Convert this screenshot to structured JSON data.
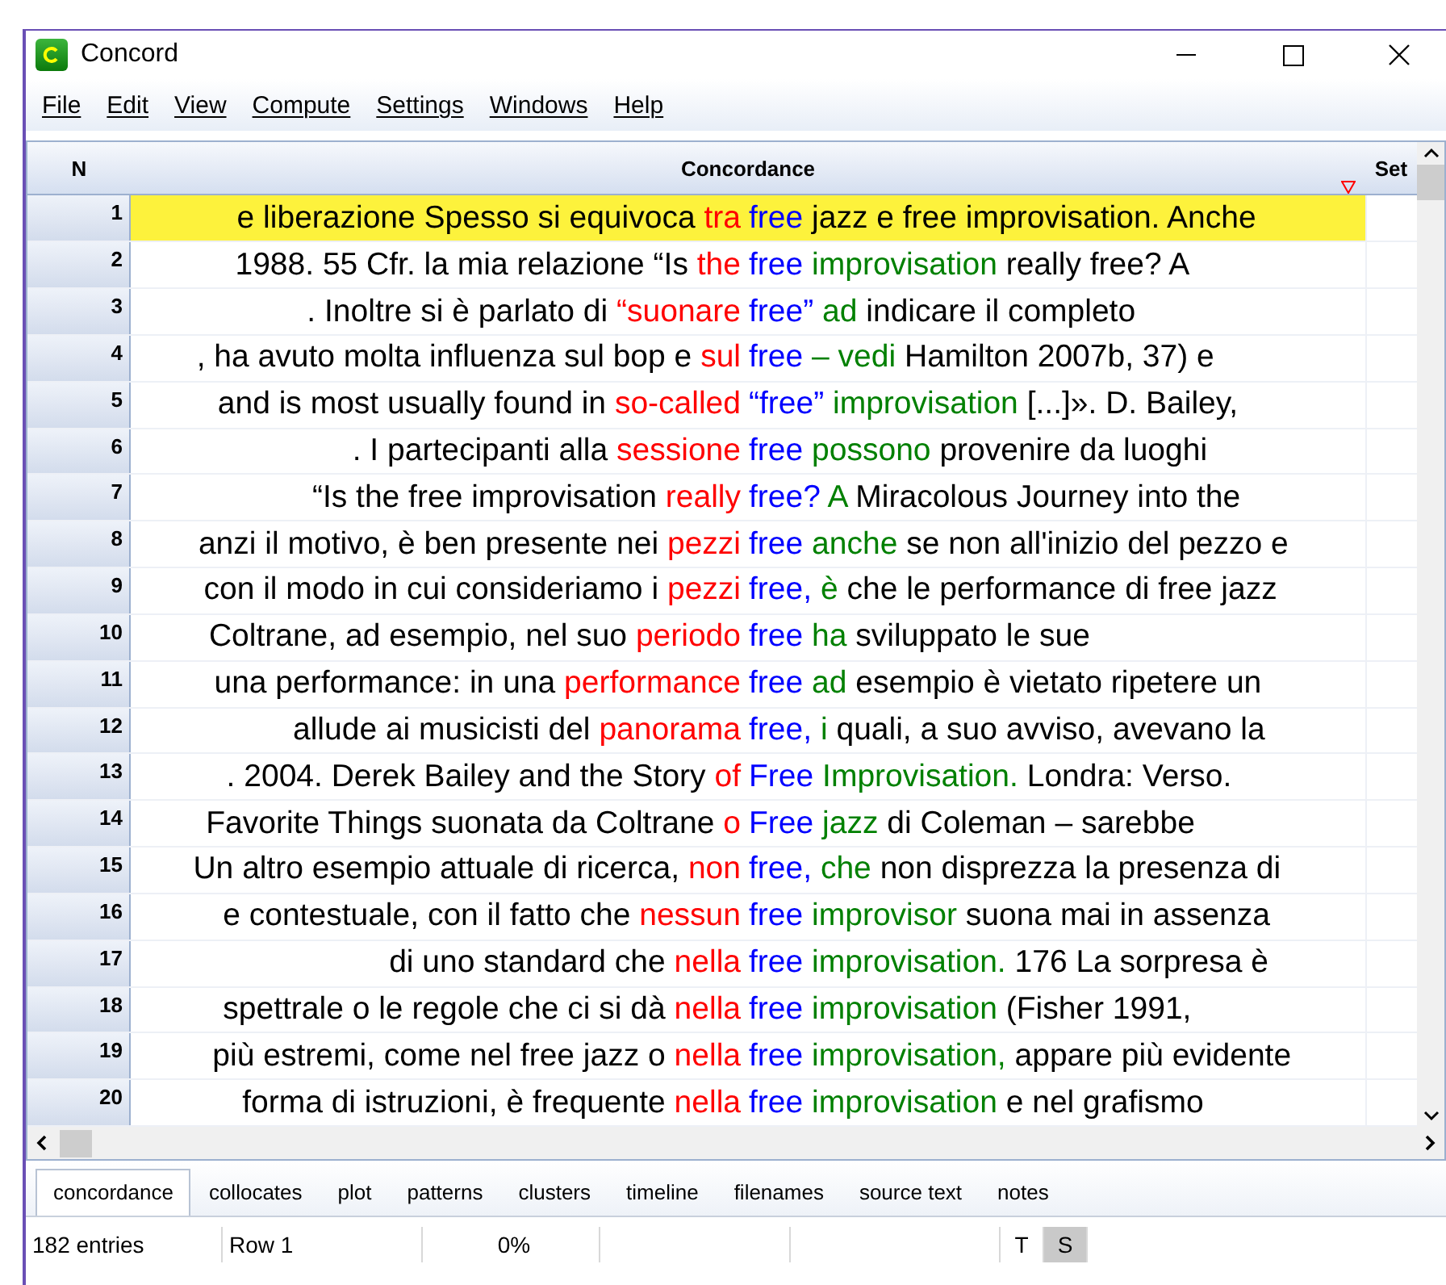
{
  "window": {
    "title": "Concord"
  },
  "menu": [
    "File",
    "Edit",
    "View",
    "Compute",
    "Settings",
    "Windows",
    "Help"
  ],
  "columns": [
    "N",
    "Concordance",
    "Set"
  ],
  "rows": [
    {
      "n": "1",
      "selected": true,
      "segments": [
        {
          "kind": "plain",
          "text": "e liberazione Spesso si equivoca"
        },
        {
          "kind": "left",
          "text": "tra"
        },
        {
          "kind": "node",
          "text": "free"
        },
        {
          "kind": "plain",
          "text": "jazz e free improvisation. Anche"
        }
      ]
    },
    {
      "n": "2",
      "selected": false,
      "segments": [
        {
          "kind": "plain",
          "text": "1988. 55 Cfr. la mia relazione “Is"
        },
        {
          "kind": "left",
          "text": "the"
        },
        {
          "kind": "node",
          "text": "free"
        },
        {
          "kind": "right",
          "text": "improvisation"
        },
        {
          "kind": "plain",
          "text": "really free? A"
        }
      ]
    },
    {
      "n": "3",
      "selected": false,
      "segments": [
        {
          "kind": "plain",
          "text": ". Inoltre si è parlato di"
        },
        {
          "kind": "left",
          "text": "“suonare"
        },
        {
          "kind": "node",
          "text": "free”"
        },
        {
          "kind": "right",
          "text": "ad"
        },
        {
          "kind": "plain",
          "text": "indicare il completo"
        }
      ]
    },
    {
      "n": "4",
      "selected": false,
      "segments": [
        {
          "kind": "plain",
          "text": ", ha avuto molta influenza sul bop e"
        },
        {
          "kind": "left",
          "text": "sul"
        },
        {
          "kind": "node",
          "text": "free"
        },
        {
          "kind": "right",
          "text": "– vedi"
        },
        {
          "kind": "plain",
          "text": "Hamilton 2007b, 37) e"
        }
      ]
    },
    {
      "n": "5",
      "selected": false,
      "segments": [
        {
          "kind": "plain",
          "text": "and is most usually found in"
        },
        {
          "kind": "left",
          "text": "so-called"
        },
        {
          "kind": "node",
          "text": "“free”"
        },
        {
          "kind": "right",
          "text": "improvisation"
        },
        {
          "kind": "plain",
          "text": "[...]». D. Bailey,"
        }
      ]
    },
    {
      "n": "6",
      "selected": false,
      "segments": [
        {
          "kind": "plain",
          "text": ". I partecipanti alla"
        },
        {
          "kind": "left",
          "text": "sessione"
        },
        {
          "kind": "node",
          "text": "free"
        },
        {
          "kind": "right",
          "text": "possono"
        },
        {
          "kind": "plain",
          "text": "provenire da luoghi"
        }
      ]
    },
    {
      "n": "7",
      "selected": false,
      "segments": [
        {
          "kind": "plain",
          "text": "“Is the free improvisation"
        },
        {
          "kind": "left",
          "text": "really"
        },
        {
          "kind": "node",
          "text": "free?"
        },
        {
          "kind": "right",
          "text": "A"
        },
        {
          "kind": "plain",
          "text": "Miracolous Journey into the"
        }
      ]
    },
    {
      "n": "8",
      "selected": false,
      "segments": [
        {
          "kind": "plain",
          "text": "anzi il motivo, è ben presente nei"
        },
        {
          "kind": "left",
          "text": "pezzi"
        },
        {
          "kind": "node",
          "text": "free"
        },
        {
          "kind": "right",
          "text": "anche"
        },
        {
          "kind": "plain",
          "text": "se non all'inizio del pezzo e"
        }
      ]
    },
    {
      "n": "9",
      "selected": false,
      "segments": [
        {
          "kind": "plain",
          "text": "con il modo in cui consideriamo i"
        },
        {
          "kind": "left",
          "text": "pezzi"
        },
        {
          "kind": "node",
          "text": "free,"
        },
        {
          "kind": "right",
          "text": "è"
        },
        {
          "kind": "plain",
          "text": "che le performance di free jazz"
        }
      ]
    },
    {
      "n": "10",
      "selected": false,
      "segments": [
        {
          "kind": "plain",
          "text": "Coltrane, ad esempio, nel suo"
        },
        {
          "kind": "left",
          "text": "periodo"
        },
        {
          "kind": "node",
          "text": "free"
        },
        {
          "kind": "right",
          "text": "ha"
        },
        {
          "kind": "plain",
          "text": "sviluppato le sue"
        }
      ]
    },
    {
      "n": "11",
      "selected": false,
      "segments": [
        {
          "kind": "plain",
          "text": "una performance: in una"
        },
        {
          "kind": "left",
          "text": "performance"
        },
        {
          "kind": "node",
          "text": "free"
        },
        {
          "kind": "right",
          "text": "ad"
        },
        {
          "kind": "plain",
          "text": "esempio è vietato ripetere un"
        }
      ]
    },
    {
      "n": "12",
      "selected": false,
      "segments": [
        {
          "kind": "plain",
          "text": "allude ai musicisti del"
        },
        {
          "kind": "left",
          "text": "panorama"
        },
        {
          "kind": "node",
          "text": "free,"
        },
        {
          "kind": "right",
          "text": "i"
        },
        {
          "kind": "plain",
          "text": "quali, a suo avviso, avevano la"
        }
      ]
    },
    {
      "n": "13",
      "selected": false,
      "segments": [
        {
          "kind": "plain",
          "text": ". 2004. Derek Bailey and the Story"
        },
        {
          "kind": "left",
          "text": "of"
        },
        {
          "kind": "node",
          "text": "Free"
        },
        {
          "kind": "right",
          "text": "Improvisation."
        },
        {
          "kind": "plain",
          "text": "Londra: Verso."
        }
      ]
    },
    {
      "n": "14",
      "selected": false,
      "segments": [
        {
          "kind": "plain",
          "text": "Favorite Things suonata da Coltrane"
        },
        {
          "kind": "left",
          "text": "o"
        },
        {
          "kind": "node",
          "text": "Free"
        },
        {
          "kind": "right",
          "text": "jazz"
        },
        {
          "kind": "plain",
          "text": "di Coleman – sarebbe"
        }
      ]
    },
    {
      "n": "15",
      "selected": false,
      "segments": [
        {
          "kind": "plain",
          "text": "Un altro esempio attuale di ricerca,"
        },
        {
          "kind": "left",
          "text": "non"
        },
        {
          "kind": "node",
          "text": "free,"
        },
        {
          "kind": "right",
          "text": "che"
        },
        {
          "kind": "plain",
          "text": "non disprezza la presenza di"
        }
      ]
    },
    {
      "n": "16",
      "selected": false,
      "segments": [
        {
          "kind": "plain",
          "text": "e contestuale, con il fatto che"
        },
        {
          "kind": "left",
          "text": "nessun"
        },
        {
          "kind": "node",
          "text": "free"
        },
        {
          "kind": "right",
          "text": "improvisor"
        },
        {
          "kind": "plain",
          "text": "suona mai in assenza"
        }
      ]
    },
    {
      "n": "17",
      "selected": false,
      "segments": [
        {
          "kind": "plain",
          "text": "di uno standard che"
        },
        {
          "kind": "left",
          "text": "nella"
        },
        {
          "kind": "node",
          "text": "free"
        },
        {
          "kind": "right",
          "text": "improvisation."
        },
        {
          "kind": "plain",
          "text": "176 La sorpresa è"
        }
      ]
    },
    {
      "n": "18",
      "selected": false,
      "segments": [
        {
          "kind": "plain",
          "text": "spettrale o le regole che ci si dà"
        },
        {
          "kind": "left",
          "text": "nella"
        },
        {
          "kind": "node",
          "text": "free"
        },
        {
          "kind": "right",
          "text": "improvisation"
        },
        {
          "kind": "plain",
          "text": "(Fisher 1991,"
        }
      ]
    },
    {
      "n": "19",
      "selected": false,
      "segments": [
        {
          "kind": "plain",
          "text": "più estremi, come nel free jazz o"
        },
        {
          "kind": "left",
          "text": "nella"
        },
        {
          "kind": "node",
          "text": "free"
        },
        {
          "kind": "right",
          "text": "improvisation,"
        },
        {
          "kind": "plain",
          "text": "appare più evidente"
        }
      ]
    },
    {
      "n": "20",
      "selected": false,
      "segments": [
        {
          "kind": "plain",
          "text": "forma di istruzioni, è frequente"
        },
        {
          "kind": "left",
          "text": "nella"
        },
        {
          "kind": "node",
          "text": "free"
        },
        {
          "kind": "right",
          "text": "improvisation"
        },
        {
          "kind": "plain",
          "text": "e nel grafismo"
        }
      ]
    }
  ],
  "tabs": [
    {
      "label": "concordance",
      "selected": true
    },
    {
      "label": "collocates",
      "selected": false
    },
    {
      "label": "plot",
      "selected": false
    },
    {
      "label": "patterns",
      "selected": false
    },
    {
      "label": "clusters",
      "selected": false
    },
    {
      "label": "timeline",
      "selected": false
    },
    {
      "label": "filenames",
      "selected": false
    },
    {
      "label": "source text",
      "selected": false
    },
    {
      "label": "notes",
      "selected": false
    }
  ],
  "status_bar": [
    {
      "text": "182 entries",
      "kind": "text"
    },
    {
      "text": "Row 1",
      "kind": "text"
    },
    {
      "text": "0%",
      "kind": "text"
    },
    {
      "text": "T",
      "kind": "toggle",
      "on": false
    },
    {
      "text": "S",
      "kind": "toggle",
      "on": true
    }
  ]
}
